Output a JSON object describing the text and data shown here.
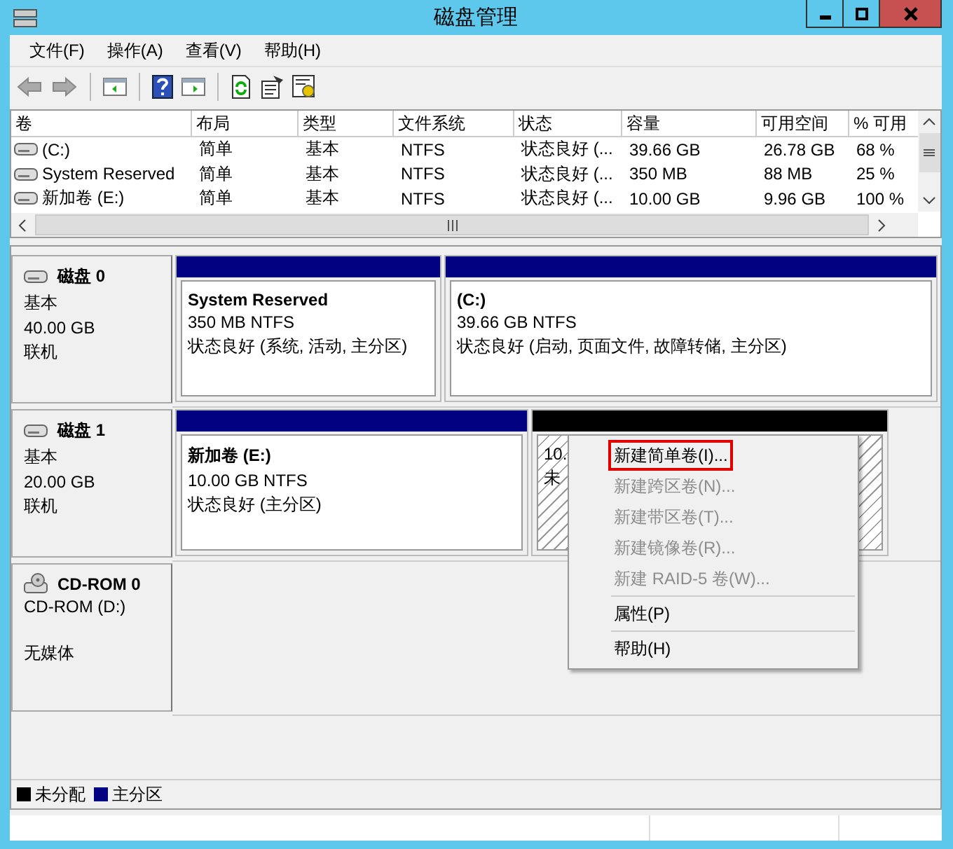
{
  "window": {
    "title": "磁盘管理"
  },
  "menu": [
    "文件(F)",
    "操作(A)",
    "查看(V)",
    "帮助(H)"
  ],
  "table": {
    "columns": [
      "卷",
      "布局",
      "类型",
      "文件系统",
      "状态",
      "容量",
      "可用空间",
      "% 可用"
    ],
    "rows": [
      [
        "(C:)",
        "简单",
        "基本",
        "NTFS",
        "状态良好 (...",
        "39.66 GB",
        "26.78 GB",
        "68 %"
      ],
      [
        "System Reserved",
        "简单",
        "基本",
        "NTFS",
        "状态良好 (...",
        "350 MB",
        "88 MB",
        "25 %"
      ],
      [
        "新加卷 (E:)",
        "简单",
        "基本",
        "NTFS",
        "状态良好 (...",
        "10.00 GB",
        "9.96 GB",
        "100 %"
      ]
    ]
  },
  "disks": [
    {
      "kind": "disk",
      "name": "磁盘 0",
      "type": "基本",
      "size": "40.00 GB",
      "status": "联机",
      "partitions": [
        {
          "kind": "primary",
          "name": "System Reserved",
          "size": "350 MB NTFS",
          "status": "状态良好 (系统, 活动, 主分区)"
        },
        {
          "kind": "primary",
          "name": "(C:)",
          "size": "39.66 GB NTFS",
          "status": "状态良好 (启动, 页面文件, 故障转储, 主分区)"
        }
      ]
    },
    {
      "kind": "disk",
      "name": "磁盘 1",
      "type": "基本",
      "size": "20.00 GB",
      "status": "联机",
      "partitions": [
        {
          "kind": "primary",
          "name": "新加卷 (E:)",
          "size": "10.00 GB NTFS",
          "status": "状态良好 (主分区)"
        },
        {
          "kind": "unallocated",
          "size": "10.",
          "status": "未"
        }
      ]
    },
    {
      "kind": "cdrom",
      "name": "CD-ROM 0",
      "type": "CD-ROM (D:)",
      "status": "无媒体"
    }
  ],
  "context_menu": [
    {
      "kind": "item",
      "label": "新建简单卷(I)...",
      "disabled": false,
      "highlighted": true
    },
    {
      "kind": "item",
      "label": "新建跨区卷(N)...",
      "disabled": true,
      "highlighted": false
    },
    {
      "kind": "item",
      "label": "新建带区卷(T)...",
      "disabled": true,
      "highlighted": false
    },
    {
      "kind": "item",
      "label": "新建镜像卷(R)...",
      "disabled": true,
      "highlighted": false
    },
    {
      "kind": "item",
      "label": "新建 RAID-5 卷(W)...",
      "disabled": true,
      "highlighted": false
    },
    {
      "kind": "separator"
    },
    {
      "kind": "item",
      "label": "属性(P)",
      "disabled": false,
      "highlighted": false
    },
    {
      "kind": "separator"
    },
    {
      "kind": "item",
      "label": "帮助(H)",
      "disabled": false,
      "highlighted": false
    }
  ],
  "legend": [
    {
      "label": "未分配",
      "color": "#000000"
    },
    {
      "label": "主分区",
      "color": "#000080"
    }
  ]
}
